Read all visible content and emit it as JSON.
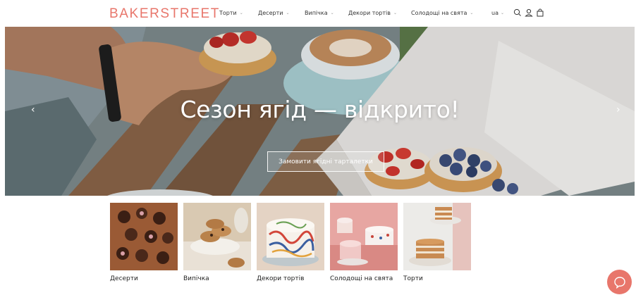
{
  "header": {
    "logo": "BAKERSTREET",
    "nav": [
      {
        "label": "Торти"
      },
      {
        "label": "Десерти"
      },
      {
        "label": "Випічка"
      },
      {
        "label": "Декори тортів"
      },
      {
        "label": "Солодощі на свята"
      }
    ],
    "lang": "ua",
    "icons": [
      "search-icon",
      "user-icon",
      "bag-icon"
    ]
  },
  "hero": {
    "title": "Сезон ягід — відкрито!",
    "button": "Замовити ягідні тарталетки",
    "prev_icon": "chevron-left-icon",
    "next_icon": "chevron-right-icon"
  },
  "categories": [
    {
      "label": "Десерти"
    },
    {
      "label": "Випічка"
    },
    {
      "label": "Декори тортів"
    },
    {
      "label": "Солодощі на свята"
    },
    {
      "label": "Торти"
    }
  ],
  "chat": {
    "icon": "chat-icon"
  },
  "colors": {
    "accent": "#e8766b"
  }
}
